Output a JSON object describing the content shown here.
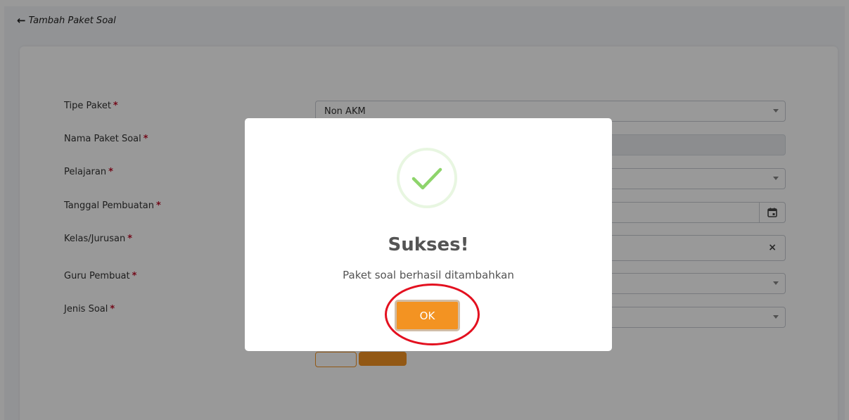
{
  "header": {
    "back_label": "Tambah Paket Soal"
  },
  "form": {
    "required_mark": "*",
    "tipe_paket": {
      "label": "Tipe Paket",
      "value": "Non AKM"
    },
    "nama_paket_soal": {
      "label": "Nama Paket Soal",
      "value": ""
    },
    "pelajaran": {
      "label": "Pelajaran",
      "value": ""
    },
    "tanggal_pembuatan": {
      "label": "Tanggal Pembuatan",
      "value": ""
    },
    "kelas_jurusan": {
      "label": "Kelas/Jurusan",
      "clear": "×"
    },
    "guru_pembuat": {
      "label": "Guru Pembuat",
      "value": ""
    },
    "jenis_soal": {
      "label": "Jenis Soal",
      "value": ""
    }
  },
  "modal": {
    "icon": "success-check-icon",
    "title": "Sukses!",
    "message": "Paket soal berhasil ditambahkan",
    "ok_label": "OK"
  },
  "colors": {
    "accent": "#f39322",
    "required": "#c0102a",
    "success": "#8ed46b",
    "annotation": "#e3101f"
  }
}
